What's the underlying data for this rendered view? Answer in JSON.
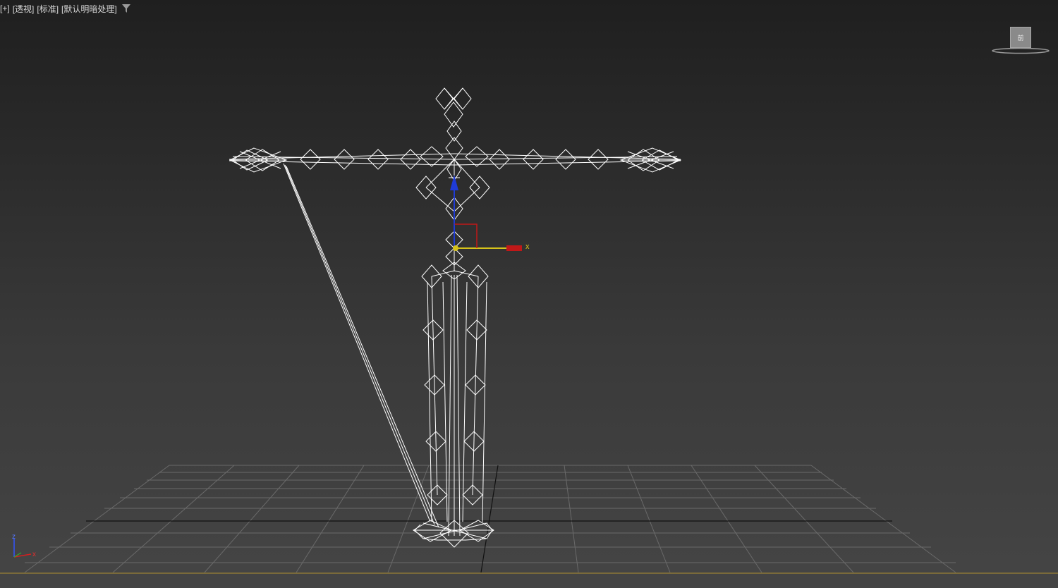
{
  "viewport": {
    "labels": [
      "[+]",
      "[透视]",
      "[标准]",
      "[默认明暗处理]"
    ],
    "filter_icon": "funnel-icon"
  },
  "viewcube": {
    "face_label": "前"
  },
  "gizmo": {
    "x_label": "x"
  },
  "axis_tripod": {
    "z_label": "z",
    "x_label": "x"
  },
  "colors": {
    "x_axis": "#d42020",
    "y_axis": "#d6c21a",
    "z_axis": "#1f3bd6",
    "wire": "#ffffff",
    "grid": "#6a6a6a"
  }
}
